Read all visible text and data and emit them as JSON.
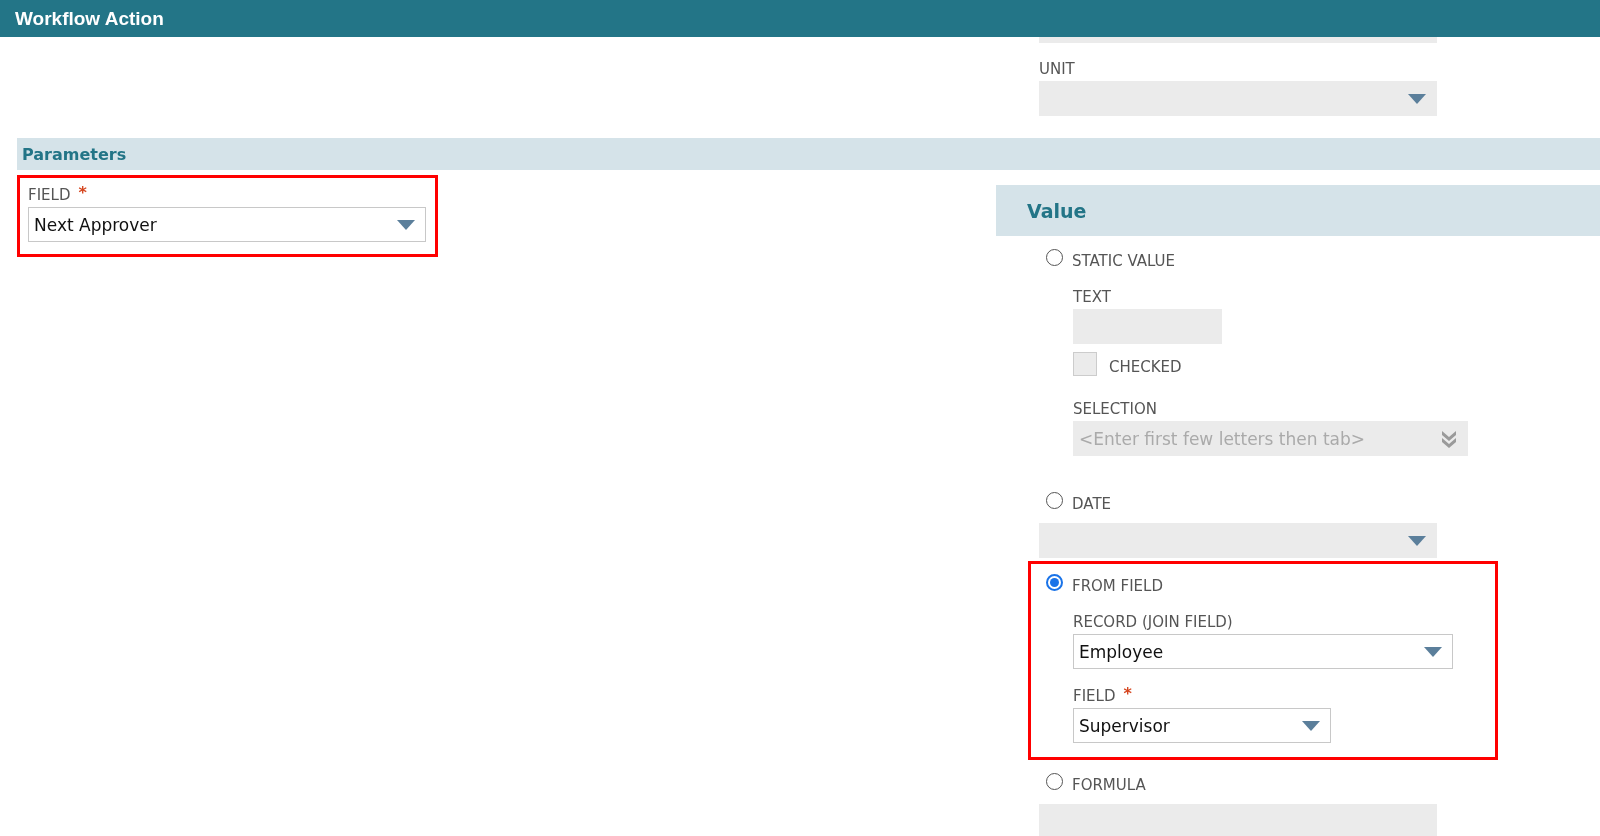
{
  "window": {
    "title": "Workflow Action"
  },
  "unit": {
    "label": "UNIT",
    "disabled": true
  },
  "parameters": {
    "title": "Parameters",
    "field": {
      "label": "FIELD",
      "required_mark": "*",
      "value": "Next Approver",
      "disabled": false,
      "highlighted": true
    }
  },
  "value": {
    "title": "Value",
    "options": [
      {
        "label": "STATIC VALUE",
        "selected": false,
        "highlighted": false,
        "fields": [
          {
            "kind": "text",
            "label": "TEXT",
            "disabled": true
          },
          {
            "kind": "checkbox",
            "label": "CHECKED",
            "checked": false
          },
          {
            "kind": "combo",
            "label": "SELECTION",
            "placeholder": "<Enter first few letters then tab>",
            "disabled": true
          }
        ]
      },
      {
        "label": "DATE",
        "selected": false,
        "highlighted": false,
        "input": {
          "kind": "select",
          "disabled": true
        }
      },
      {
        "label": "FROM FIELD",
        "selected": true,
        "highlighted": true,
        "fields": [
          {
            "kind": "select",
            "label": "RECORD (JOIN FIELD)",
            "value": "Employee",
            "disabled": false
          },
          {
            "kind": "select",
            "label": "FIELD",
            "required_mark": "*",
            "value": "Supervisor",
            "disabled": false
          }
        ]
      },
      {
        "label": "FORMULA",
        "selected": false,
        "highlighted": false,
        "input": {
          "kind": "textarea",
          "disabled": true
        }
      }
    ]
  }
}
